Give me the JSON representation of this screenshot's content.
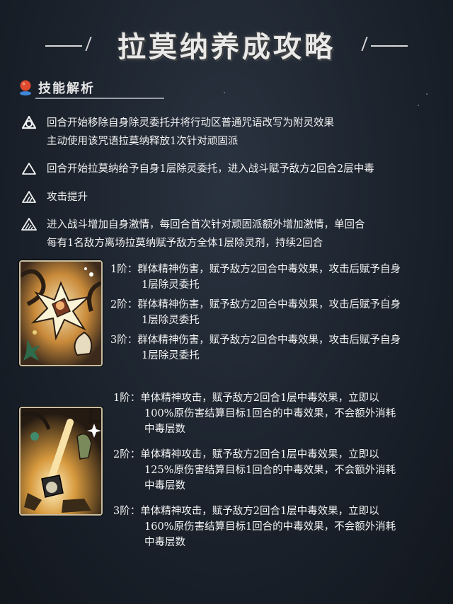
{
  "header": {
    "title": "拉莫纳养成攻略"
  },
  "section": {
    "label": "技能解析"
  },
  "passives": [
    {
      "icon": "tier-icon-1",
      "lines": [
        "回合开始移除自身除灵委托并将行动区普通咒语改写为附灵效果",
        "主动使用该咒语拉莫纳释放1次针对顽固派"
      ]
    },
    {
      "icon": "tier-icon-2",
      "lines": [
        "回合开始拉莫纳给予自身1层除灵委托，进入战斗赋予敌方2回合2层中毒"
      ]
    },
    {
      "icon": "tier-icon-3",
      "lines": [
        "攻击提升"
      ]
    },
    {
      "icon": "tier-icon-4",
      "lines": [
        "进入战斗增加自身激情，每回合首次针对顽固派额外增加激情，单回合",
        "每有1名敌方离场拉莫纳赋予敌方全体1层除灵剂，持续2回合"
      ]
    }
  ],
  "skill1": {
    "card_icon": "firework-burst-card-icon",
    "levels": [
      {
        "prefix": "1阶：",
        "line1": "群体精神伤害，赋予敌方2回合中毒效果，攻击后赋予自身",
        "line2": "1层除灵委托"
      },
      {
        "prefix": "2阶：",
        "line1": "群体精神伤害，赋予敌方2回合中毒效果，攻击后赋予自身",
        "line2": "1层除灵委托"
      },
      {
        "prefix": "3阶：",
        "line1": "群体精神伤害，赋予敌方2回合中毒效果，攻击后赋予自身",
        "line2": "1层除灵委托"
      }
    ]
  },
  "skill2": {
    "card_icon": "shovel-strike-card-icon",
    "levels": [
      {
        "prefix": "1阶：",
        "line1": "单体精神攻击，赋予敌方2回合1层中毒效果，立即以",
        "line2": "100%原伤害结算目标1回合的中毒效果，不会额外消耗",
        "line3": "中毒层数"
      },
      {
        "prefix": "2阶：",
        "line1": "单体精神攻击，赋予敌方2回合1层中毒效果，立即以",
        "line2": "125%原伤害结算目标1回合的中毒效果，不会额外消耗",
        "line3": "中毒层数"
      },
      {
        "prefix": "3阶：",
        "line1": "单体精神攻击，赋予敌方2回合1层中毒效果，立即以",
        "line2": "160%原伤害结算目标1回合的中毒效果，不会额外消耗",
        "line3": "中毒层数"
      }
    ]
  },
  "colors": {
    "background": "#1b222c",
    "text": "#f3f3f3",
    "card_border": "#c9bfa4",
    "section_pin": "#e04a2f"
  }
}
